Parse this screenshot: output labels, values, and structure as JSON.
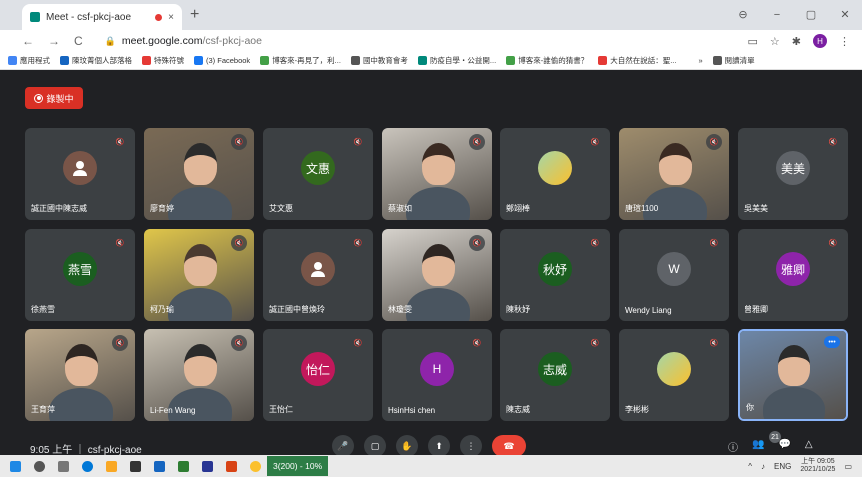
{
  "browser": {
    "tab_title": "Meet - csf-pkcj-aoe",
    "tab_close": "×",
    "new_tab": "+",
    "window_controls": [
      "⊖",
      "−",
      "▢",
      "✕"
    ],
    "nav": [
      "←",
      "→",
      "C"
    ],
    "url_host": "meet.google.com",
    "url_path": "/csf-pkcj-aoe",
    "lock": "🔒",
    "profile_initial": "H",
    "ext_icons": [
      "▭",
      "☆",
      "✱"
    ],
    "menu": "⋮"
  },
  "bookmarks": [
    {
      "label": "應用程式",
      "color": "#4285f4"
    },
    {
      "label": "陳玟菁個人部落格",
      "color": "#1565c0"
    },
    {
      "label": "特殊符號",
      "color": "#e53935"
    },
    {
      "label": "(3) Facebook",
      "color": "#1877f2"
    },
    {
      "label": "博客來-再見了，利...",
      "color": "#43a047"
    },
    {
      "label": "國中教育會考",
      "color": "#555555"
    },
    {
      "label": "防疫自學・公益開...",
      "color": "#00897b"
    },
    {
      "label": "博客來-誰偷的猜書？",
      "color": "#43a047"
    },
    {
      "label": "大自然在說話：聖...",
      "color": "#e53935"
    },
    {
      "label": "»",
      "color": "transparent"
    },
    {
      "label": "閱讀清單",
      "color": "#555555"
    }
  ],
  "meet": {
    "record_label": "錄製中",
    "time_text": "9:05 上午 ｜ csf-pkcj-aoe",
    "participant_badge": "21",
    "controls": [
      "🎤",
      "▢",
      "✋",
      "⬆",
      "⋮",
      "☎"
    ],
    "right_controls": [
      "ⓘ",
      "👥",
      "💬",
      "△"
    ],
    "tiles": [
      {
        "name": "誠正國中陳志威",
        "type": "face-icon",
        "muted": true
      },
      {
        "name": "廖育婷",
        "type": "video",
        "muted": true
      },
      {
        "name": "艾文惠",
        "type": "avatar",
        "initial": "文惠",
        "color": "#33691e",
        "muted": true
      },
      {
        "name": "蔡淑如",
        "type": "video",
        "muted": true
      },
      {
        "name": "鄭翊棒",
        "type": "image-avatar",
        "muted": true
      },
      {
        "name": "唐瑄1100",
        "type": "video",
        "muted": true
      },
      {
        "name": "吳美美",
        "type": "avatar",
        "initial": "美美",
        "color": "#5f6368",
        "muted": true
      },
      {
        "name": "徐燕雪",
        "type": "avatar",
        "initial": "燕雪",
        "color": "#1b5e20",
        "muted": true
      },
      {
        "name": "柯乃瑜",
        "type": "video",
        "muted": true
      },
      {
        "name": "誠正國中曾煥玲",
        "type": "face-icon",
        "muted": true
      },
      {
        "name": "林瓊雯",
        "type": "video",
        "muted": true
      },
      {
        "name": "陳秋妤",
        "type": "avatar",
        "initial": "秋妤",
        "color": "#1b5e20",
        "muted": true
      },
      {
        "name": "Wendy Liang",
        "type": "avatar",
        "initial": "W",
        "color": "#5f6368",
        "muted": true
      },
      {
        "name": "曾雅卿",
        "type": "avatar",
        "initial": "雅卿",
        "color": "#8e24aa",
        "muted": true
      },
      {
        "name": "王育萍",
        "type": "video",
        "muted": true
      },
      {
        "name": "Li-Fen Wang",
        "type": "video",
        "muted": true
      },
      {
        "name": "王怡仁",
        "type": "avatar",
        "initial": "怡仁",
        "color": "#c2185b",
        "muted": true
      },
      {
        "name": "HsinHsi chen",
        "type": "avatar",
        "initial": "H",
        "color": "#8e24aa",
        "muted": true
      },
      {
        "name": "陳志威",
        "type": "avatar",
        "initial": "志威",
        "color": "#1b5e20",
        "muted": true
      },
      {
        "name": "李彬彬",
        "type": "image-avatar",
        "muted": true
      },
      {
        "name": "你",
        "type": "video-self",
        "muted": false
      }
    ]
  },
  "taskbar": {
    "active_app": "3(200) - 10%",
    "lang": "ENG",
    "clock_time": "上午 09:05",
    "clock_date": "2021/10/25"
  },
  "colors": {
    "meet_bg": "#202124",
    "tile_bg": "#3c4043",
    "record": "#d93025",
    "self_border": "#8ab4f8"
  }
}
